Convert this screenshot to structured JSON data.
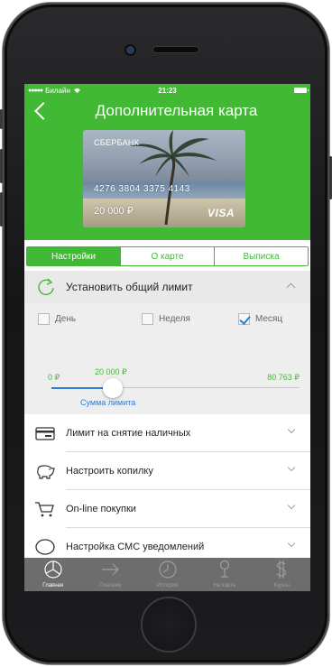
{
  "status_bar": {
    "carrier": "Билайн",
    "time": "21:23"
  },
  "header": {
    "title": "Дополнительная карта"
  },
  "card": {
    "bank": "СБЕРБАНК",
    "number": "4276 3804 3375 4143",
    "balance": "20 000 ₽",
    "brand": "VISA"
  },
  "tabs": [
    {
      "label": "Настройки",
      "active": true
    },
    {
      "label": "О карте",
      "active": false
    },
    {
      "label": "Выписка",
      "active": false
    }
  ],
  "limit": {
    "title": "Установить общий лимит",
    "periods": [
      {
        "label": "День",
        "checked": false
      },
      {
        "label": "Неделя",
        "checked": false
      },
      {
        "label": "Месяц",
        "checked": true
      }
    ],
    "slider": {
      "min_label": "0 ₽",
      "value_label": "20 000 ₽",
      "max_label": "80 763 ₽",
      "min": 0,
      "value": 20000,
      "max": 80763,
      "caption": "Сумма лимита"
    }
  },
  "list_items": [
    {
      "label": "Лимит на снятие наличных",
      "icon": "card-icon"
    },
    {
      "label": "Настроить копилку",
      "icon": "piggy-bank-icon"
    },
    {
      "label": "On-line покупки",
      "icon": "shopping-cart-icon"
    },
    {
      "label": "Настройка СМС уведомлений",
      "icon": "speech-bubble-icon"
    }
  ],
  "tabbar": [
    {
      "label": "Главная",
      "icon": "home-pie-icon",
      "active": true
    },
    {
      "label": "Платежи",
      "icon": "arrow-right-icon",
      "active": false
    },
    {
      "label": "История",
      "icon": "clock-icon",
      "active": false
    },
    {
      "label": "На карте",
      "icon": "map-pin-icon",
      "active": false
    },
    {
      "label": "Курсы",
      "icon": "dollar-icon",
      "active": false
    }
  ],
  "colors": {
    "brand_green": "#42b935",
    "accent_blue": "#2d7cd6",
    "tabbar_bg": "#5a5a5a"
  }
}
